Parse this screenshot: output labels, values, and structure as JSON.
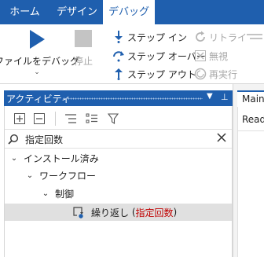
{
  "ribbon": {
    "tabs": [
      {
        "label": "ホーム",
        "active": false
      },
      {
        "label": "デザイン",
        "active": false
      },
      {
        "label": "デバッグ",
        "active": true
      }
    ],
    "debug_file_label": "ファイルをデバッグ",
    "stop_label": "停止",
    "step_into_label": "ステップ イン",
    "step_over_label": "ステップ オーバー",
    "step_out_label": "ステップ アウト",
    "retry_label": "リトライ",
    "ignore_label": "無視",
    "rerun_label": "再実行"
  },
  "panel": {
    "title": "アクティビティ",
    "search_value": "指定回数",
    "tree": [
      {
        "label": "インストール済み",
        "level": 0,
        "expanded": true
      },
      {
        "label": "ワークフロー",
        "level": 1,
        "expanded": true
      },
      {
        "label": "制御",
        "level": 2,
        "expanded": true
      }
    ],
    "result": {
      "label": "繰り返し",
      "match": "指定回数"
    }
  },
  "document": {
    "tab_label": "Main",
    "row_text": "Read"
  },
  "colors": {
    "accent": "#1f5fae",
    "match_red": "#c00000",
    "selected_row": "#e0e0e0"
  }
}
